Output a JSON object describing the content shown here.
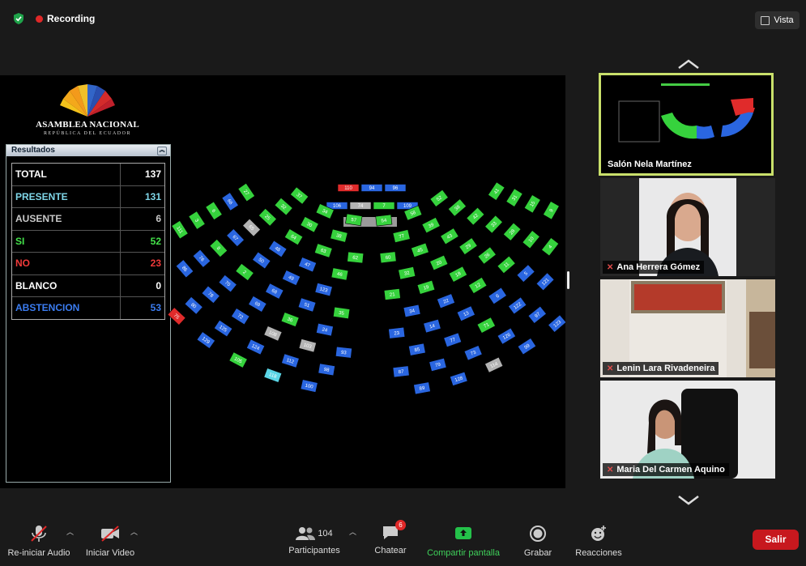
{
  "topbar": {
    "recording_label": "Recording",
    "view_label": "Vista"
  },
  "logo": {
    "title": "ASAMBLEA NACIONAL",
    "subtitle": "REPÚBLICA DEL ECUADOR"
  },
  "results": {
    "panel_title": "Resultados",
    "rows": [
      {
        "label": "TOTAL",
        "value": "137",
        "color": "#ffffff"
      },
      {
        "label": "PRESENTE",
        "value": "131",
        "color": "#7fd6e8"
      },
      {
        "label": "AUSENTE",
        "value": "6",
        "color": "#c8c8c8"
      },
      {
        "label": "SI",
        "value": "52",
        "color": "#44e24a"
      },
      {
        "label": "NO",
        "value": "23",
        "color": "#f23a3a"
      },
      {
        "label": "BLANCO",
        "value": "0",
        "color": "#ffffff"
      },
      {
        "label": "ABSTENCION",
        "value": "53",
        "color": "#3b7cf0"
      }
    ]
  },
  "vote_colors": {
    "G": "#36d23d",
    "B": "#2a66e0",
    "R": "#e02b2b",
    "W": "#b3b3b3",
    "C": "#5ad5e6"
  },
  "presidium": {
    "row1": [
      {
        "n": "110",
        "s": "R"
      },
      {
        "n": "94",
        "s": "B"
      },
      {
        "n": "96",
        "s": "B"
      }
    ],
    "row2": [
      {
        "n": "106",
        "s": "B"
      },
      {
        "n": "74",
        "s": "W"
      },
      {
        "n": "7",
        "s": "G"
      },
      {
        "n": "109",
        "s": "B"
      }
    ]
  },
  "seats": [
    {
      "n": "52",
      "s": "G"
    },
    {
      "n": "58",
      "s": "G"
    },
    {
      "n": "54",
      "s": "G"
    },
    {
      "n": "57",
      "s": "G"
    },
    {
      "n": "34",
      "s": "G"
    },
    {
      "n": "37",
      "s": "G"
    },
    {
      "n": "38",
      "s": "G"
    },
    {
      "n": "39",
      "s": "G"
    },
    {
      "n": "77",
      "s": "G"
    },
    {
      "n": "38",
      "s": "G"
    },
    {
      "n": "30",
      "s": "G"
    },
    {
      "n": "32",
      "s": "G"
    },
    {
      "n": "41",
      "s": "G"
    },
    {
      "n": "42",
      "s": "G"
    },
    {
      "n": "43",
      "s": "G"
    },
    {
      "n": "45",
      "s": "G"
    },
    {
      "n": "60",
      "s": "G"
    },
    {
      "n": "62",
      "s": "G"
    },
    {
      "n": "63",
      "s": "G"
    },
    {
      "n": "64",
      "s": "G"
    },
    {
      "n": "25",
      "s": "G"
    },
    {
      "n": "27",
      "s": "G"
    },
    {
      "n": "31",
      "s": "G"
    },
    {
      "n": "33",
      "s": "G"
    },
    {
      "n": "29",
      "s": "G"
    },
    {
      "n": "20",
      "s": "G"
    },
    {
      "n": "32",
      "s": "G"
    },
    {
      "n": "46",
      "s": "G"
    },
    {
      "n": "47",
      "s": "B"
    },
    {
      "n": "48",
      "s": "B"
    },
    {
      "n": "65",
      "s": "W"
    },
    {
      "n": "66",
      "s": "B"
    },
    {
      "n": "15",
      "s": "G"
    },
    {
      "n": "28",
      "s": "G"
    },
    {
      "n": "26",
      "s": "G"
    },
    {
      "n": "18",
      "s": "G"
    },
    {
      "n": "19",
      "s": "G"
    },
    {
      "n": "21",
      "s": "G"
    },
    {
      "n": "123",
      "s": "B"
    },
    {
      "n": "49",
      "s": "B"
    },
    {
      "n": "50",
      "s": "B"
    },
    {
      "n": "67",
      "s": "B"
    },
    {
      "n": "6",
      "s": "G"
    },
    {
      "n": "9",
      "s": "G"
    },
    {
      "n": "10",
      "s": "G"
    },
    {
      "n": "11",
      "s": "G"
    },
    {
      "n": "12",
      "s": "G"
    },
    {
      "n": "22",
      "s": "B"
    },
    {
      "n": "34",
      "s": "B"
    },
    {
      "n": "35",
      "s": "G"
    },
    {
      "n": "51",
      "s": "B"
    },
    {
      "n": "68",
      "s": "B"
    },
    {
      "n": "2",
      "s": "G"
    },
    {
      "n": "8",
      "s": "G"
    },
    {
      "n": "3",
      "s": "G"
    },
    {
      "n": "4",
      "s": "G"
    },
    {
      "n": "5",
      "s": "B"
    },
    {
      "n": "6",
      "s": "B"
    },
    {
      "n": "13",
      "s": "B"
    },
    {
      "n": "14",
      "s": "B"
    },
    {
      "n": "23",
      "s": "B"
    },
    {
      "n": "24",
      "s": "B"
    },
    {
      "n": "36",
      "s": "G"
    },
    {
      "n": "69",
      "s": "B"
    },
    {
      "n": "70",
      "s": "B"
    },
    {
      "n": "76",
      "s": "B"
    },
    {
      "n": "111",
      "s": "G"
    },
    {
      "n": "121",
      "s": "B"
    },
    {
      "n": "122",
      "s": "B"
    },
    {
      "n": "71",
      "s": "G"
    },
    {
      "n": "77",
      "s": "B"
    },
    {
      "n": "85",
      "s": "B"
    },
    {
      "n": "93",
      "s": "B"
    },
    {
      "n": "103",
      "s": "W"
    },
    {
      "n": "108",
      "s": "W"
    },
    {
      "n": "72",
      "s": "B"
    },
    {
      "n": "78",
      "s": "B"
    },
    {
      "n": "86",
      "s": "B"
    },
    {
      "n": "97",
      "s": "B"
    },
    {
      "n": "126",
      "s": "B"
    },
    {
      "n": "73",
      "s": "B"
    },
    {
      "n": "79",
      "s": "B"
    },
    {
      "n": "87",
      "s": "B"
    },
    {
      "n": "98",
      "s": "B"
    },
    {
      "n": "112",
      "s": "B"
    },
    {
      "n": "124",
      "s": "B"
    },
    {
      "n": "125",
      "s": "B"
    },
    {
      "n": "80",
      "s": "B"
    },
    {
      "n": "123",
      "s": "B"
    },
    {
      "n": "99",
      "s": "B"
    },
    {
      "n": "114",
      "s": "W"
    },
    {
      "n": "128",
      "s": "B"
    },
    {
      "n": "89",
      "s": "B"
    },
    {
      "n": "100",
      "s": "B"
    },
    {
      "n": "118",
      "s": "C"
    },
    {
      "n": "105",
      "s": "G"
    },
    {
      "n": "129",
      "s": "B"
    },
    {
      "n": "75",
      "s": "R"
    },
    {
      "n": "81",
      "s": "R"
    },
    {
      "n": "82",
      "s": "R"
    },
    {
      "n": "91",
      "s": "R"
    },
    {
      "n": "90",
      "s": "R"
    },
    {
      "n": "101",
      "s": "R"
    },
    {
      "n": "130",
      "s": "R"
    },
    {
      "n": "20",
      "s": "R"
    },
    {
      "n": "113",
      "s": "B"
    },
    {
      "n": "93",
      "s": "R"
    },
    {
      "n": "83",
      "s": "R"
    },
    {
      "n": "92",
      "s": "R"
    },
    {
      "n": "102",
      "s": "R"
    },
    {
      "n": "117",
      "s": "R"
    },
    {
      "n": "133",
      "s": "R"
    },
    {
      "n": "95",
      "s": "R"
    },
    {
      "n": "116",
      "s": "R"
    },
    {
      "n": "132",
      "s": "R"
    },
    {
      "n": "134",
      "s": "R"
    },
    {
      "n": "120",
      "s": "R"
    },
    {
      "n": "105",
      "s": "W"
    },
    {
      "n": "104",
      "s": "B"
    },
    {
      "n": "119",
      "s": "R"
    },
    {
      "n": "127",
      "s": "R"
    },
    {
      "n": "88",
      "s": "R"
    },
    {
      "n": "120",
      "s": "R"
    },
    {
      "n": "137",
      "s": "C"
    },
    {
      "n": "136",
      "s": "B"
    },
    {
      "n": "139",
      "s": "B"
    },
    {
      "n": "114",
      "s": "R"
    }
  ],
  "participants": [
    {
      "name": "Salón Nela Martínez"
    },
    {
      "name": "Ana Herrera Gómez"
    },
    {
      "name": "Lenin Lara Rivadeneira"
    },
    {
      "name": "Maria Del Carmen Aquino"
    }
  ],
  "toolbar": {
    "audio_label": "Re-iniciar Audio",
    "video_label": "Iniciar Video",
    "participants_label": "Participantes",
    "participants_count": "104",
    "chat_label": "Chatear",
    "chat_badge": "6",
    "share_label": "Compartir pantalla",
    "record_label": "Grabar",
    "reactions_label": "Reacciones",
    "leave_label": "Salir"
  }
}
